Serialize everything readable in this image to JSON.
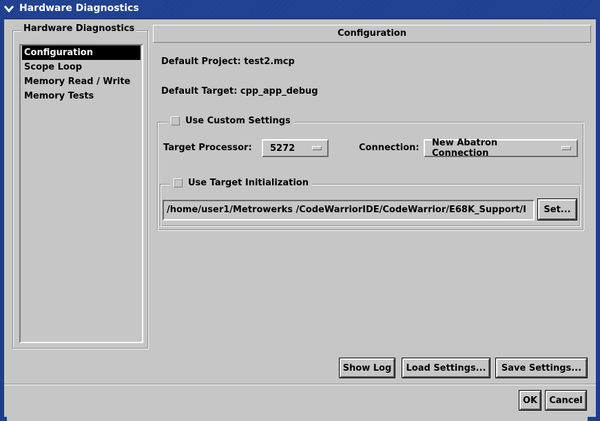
{
  "window": {
    "title": "Hardware Diagnostics",
    "menu_icon": "chevron-down-icon"
  },
  "sidebar": {
    "group_label": "Hardware Diagnostics",
    "items": [
      {
        "label": "Configuration",
        "selected": true
      },
      {
        "label": "Scope Loop",
        "selected": false
      },
      {
        "label": "Memory Read / Write",
        "selected": false
      },
      {
        "label": "Memory Tests",
        "selected": false
      }
    ]
  },
  "panel": {
    "header": "Configuration",
    "default_project": "Default Project: test2.mcp",
    "default_target": "Default Target: cpp_app_debug"
  },
  "custom_settings": {
    "checkbox_label": "Use Custom Settings",
    "checked": false,
    "target_processor_label": "Target Processor:",
    "target_processor_value": "5272",
    "connection_label": "Connection:",
    "connection_value": "New Abatron Connection"
  },
  "target_init": {
    "checkbox_label": "Use Target Initialization",
    "checked": false,
    "path_value": "/home/user1/Metrowerks  /CodeWarriorIDE/CodeWarrior/E68K_Support/I",
    "set_button": "Set..."
  },
  "actions": {
    "show_log": "Show Log",
    "load_settings": "Load Settings...",
    "save_settings": "Save Settings..."
  },
  "dialog_buttons": {
    "ok": "OK",
    "cancel": "Cancel"
  },
  "colors": {
    "titlebar": "#1c3e8e",
    "background": "#c6c6c6",
    "selection": "#000000"
  }
}
